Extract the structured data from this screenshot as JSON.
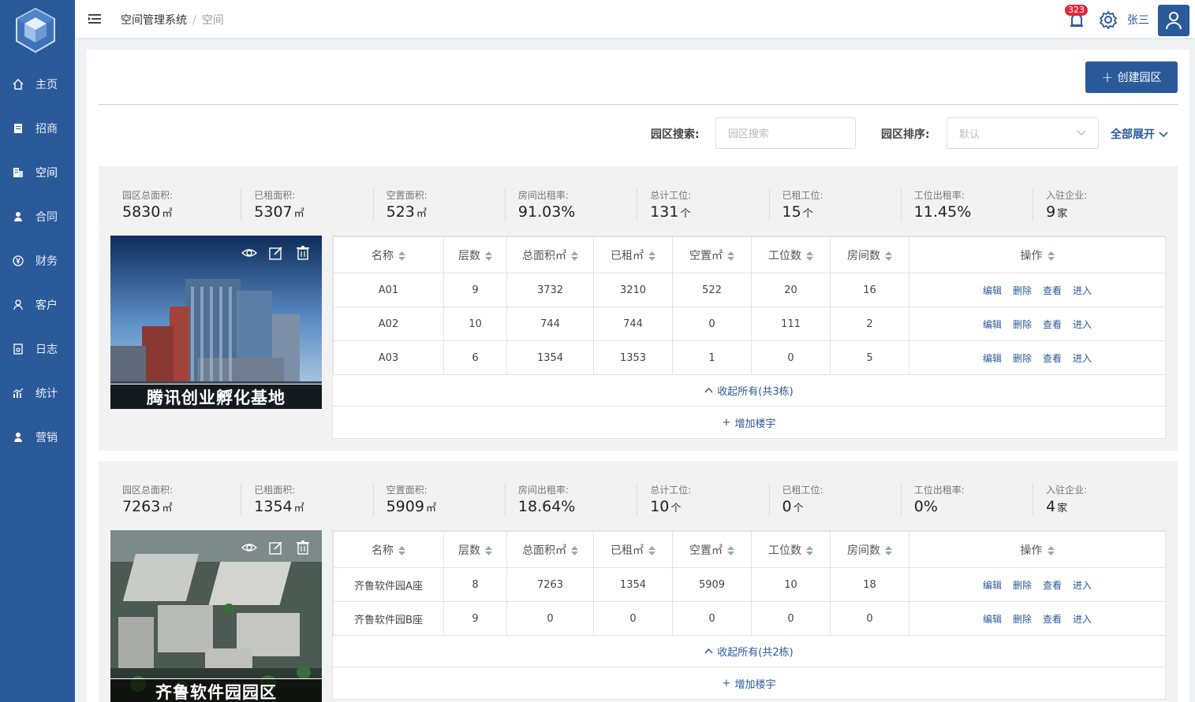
{
  "colors": {
    "brand": "#2b5a9a",
    "badge": "#e0263a"
  },
  "header": {
    "breadcrumb_root": "空间管理系统",
    "breadcrumb_sep": "/",
    "breadcrumb_current": "空间",
    "notification_count": "323",
    "username": "张三"
  },
  "sidebar": {
    "items": [
      {
        "label": "主页",
        "icon": "home-icon"
      },
      {
        "label": "招商",
        "icon": "document-icon"
      },
      {
        "label": "空间",
        "icon": "building-icon"
      },
      {
        "label": "合同",
        "icon": "user-icon"
      },
      {
        "label": "财务",
        "icon": "yen-icon"
      },
      {
        "label": "客户",
        "icon": "person-icon"
      },
      {
        "label": "日志",
        "icon": "log-icon"
      },
      {
        "label": "统计",
        "icon": "chart-icon"
      },
      {
        "label": "营销",
        "icon": "marketing-icon"
      }
    ],
    "active_index": 2
  },
  "toolbar": {
    "create_label": "创建园区",
    "search_label": "园区搜索:",
    "search_placeholder": "园区搜索",
    "sort_label": "园区排序:",
    "sort_value": "默认",
    "expand_all": "全部展开"
  },
  "table_headers": [
    "名称",
    "层数",
    "总面积㎡",
    "已租㎡",
    "空置㎡",
    "工位数",
    "房间数",
    "操作"
  ],
  "actions": [
    "编辑",
    "删除",
    "查看",
    "进入"
  ],
  "add_building": "增加楼宇",
  "parks": [
    {
      "name": "腾讯创业孵化基地",
      "stats": [
        {
          "label": "园区总面积:",
          "value": "5830",
          "unit": "㎡"
        },
        {
          "label": "已租面积:",
          "value": "5307",
          "unit": "㎡"
        },
        {
          "label": "空置面积:",
          "value": "523",
          "unit": "㎡"
        },
        {
          "label": "房间出租率:",
          "value": "91.03%",
          "unit": ""
        },
        {
          "label": "总计工位:",
          "value": "131",
          "unit": "个"
        },
        {
          "label": "已租工位:",
          "value": "15",
          "unit": "个"
        },
        {
          "label": "工位出租率:",
          "value": "11.45%",
          "unit": ""
        },
        {
          "label": "入驻企业:",
          "value": "9",
          "unit": "家"
        }
      ],
      "rows": [
        [
          "A01",
          "9",
          "3732",
          "3210",
          "522",
          "20",
          "16"
        ],
        [
          "A02",
          "10",
          "744",
          "744",
          "0",
          "111",
          "2"
        ],
        [
          "A03",
          "6",
          "1354",
          "1353",
          "1",
          "0",
          "5"
        ]
      ],
      "collapse_label": "收起所有(共3栋)"
    },
    {
      "name": "齐鲁软件园园区",
      "stats": [
        {
          "label": "园区总面积:",
          "value": "7263",
          "unit": "㎡"
        },
        {
          "label": "已租面积:",
          "value": "1354",
          "unit": "㎡"
        },
        {
          "label": "空置面积:",
          "value": "5909",
          "unit": "㎡"
        },
        {
          "label": "房间出租率:",
          "value": "18.64%",
          "unit": ""
        },
        {
          "label": "总计工位:",
          "value": "10",
          "unit": "个"
        },
        {
          "label": "已租工位:",
          "value": "0",
          "unit": "个"
        },
        {
          "label": "工位出租率:",
          "value": "0%",
          "unit": ""
        },
        {
          "label": "入驻企业:",
          "value": "4",
          "unit": "家"
        }
      ],
      "rows": [
        [
          "齐鲁软件园A座",
          "8",
          "7263",
          "1354",
          "5909",
          "10",
          "18"
        ],
        [
          "齐鲁软件园B座",
          "9",
          "0",
          "0",
          "0",
          "0",
          "0"
        ]
      ],
      "collapse_label": "收起所有(共2栋)"
    }
  ]
}
